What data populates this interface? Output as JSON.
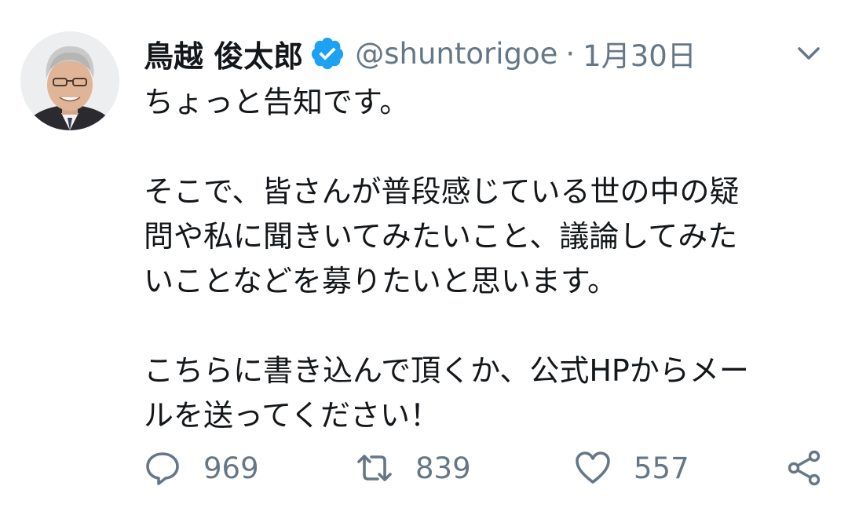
{
  "tweet": {
    "author_name": "鳥越 俊太郎",
    "handle": "@shuntorigoe",
    "separator": "·",
    "date": "1月30日",
    "verified": true,
    "avatar_icon": "person-avatar",
    "menu_icon": "chevron-down-icon",
    "paragraphs": [
      "ちょっと告知です。",
      "そこで、皆さんが普段感じている世の中の疑\n問や私に聞きいてみたいこと、議論してみた\nいことなどを募りたいと思います。",
      "こちらに書き込んで頂くか、公式HPからメー\nルを送ってください！"
    ]
  },
  "actions": {
    "reply_count": "969",
    "retweet_count": "839",
    "like_count": "557",
    "reply_icon": "reply-icon",
    "retweet_icon": "retweet-icon",
    "like_icon": "heart-icon",
    "share_icon": "share-icon"
  },
  "colors": {
    "text": "#14171a",
    "secondary": "#657786",
    "verified": "#1da1f2",
    "background": "#ffffff"
  }
}
